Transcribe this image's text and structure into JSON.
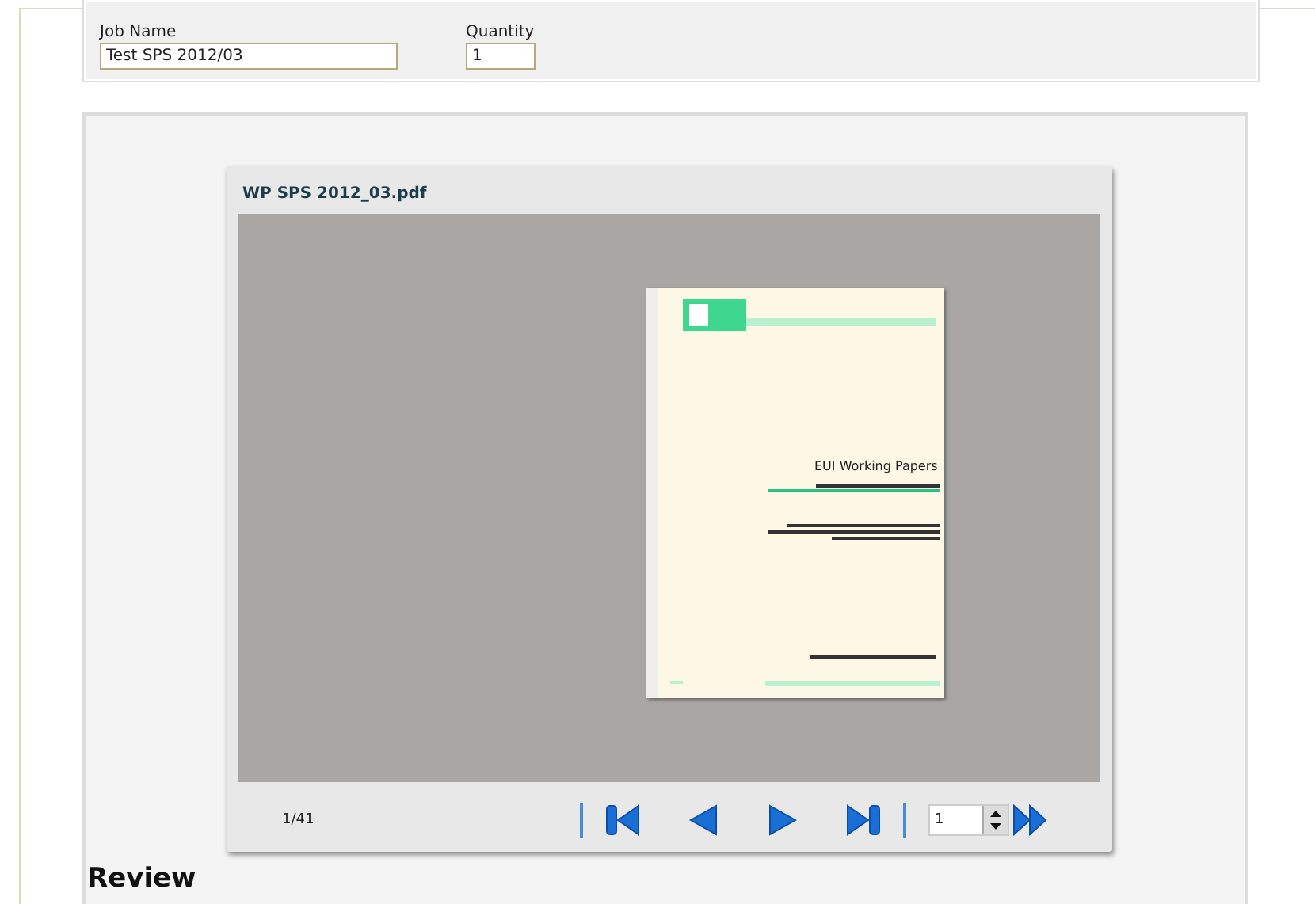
{
  "job_form": {
    "fields": [
      {
        "label": "Job Name",
        "value": "Test SPS 2012/03",
        "kind": "wide"
      },
      {
        "label": "Quantity",
        "value": "1",
        "kind": "narrow"
      }
    ]
  },
  "viewer": {
    "title": "WP SPS 2012_03.pdf",
    "document": {
      "title": "EUI Working Papers"
    },
    "page_counter": "1/41",
    "page_input": "1"
  },
  "section_heading": "Review"
}
